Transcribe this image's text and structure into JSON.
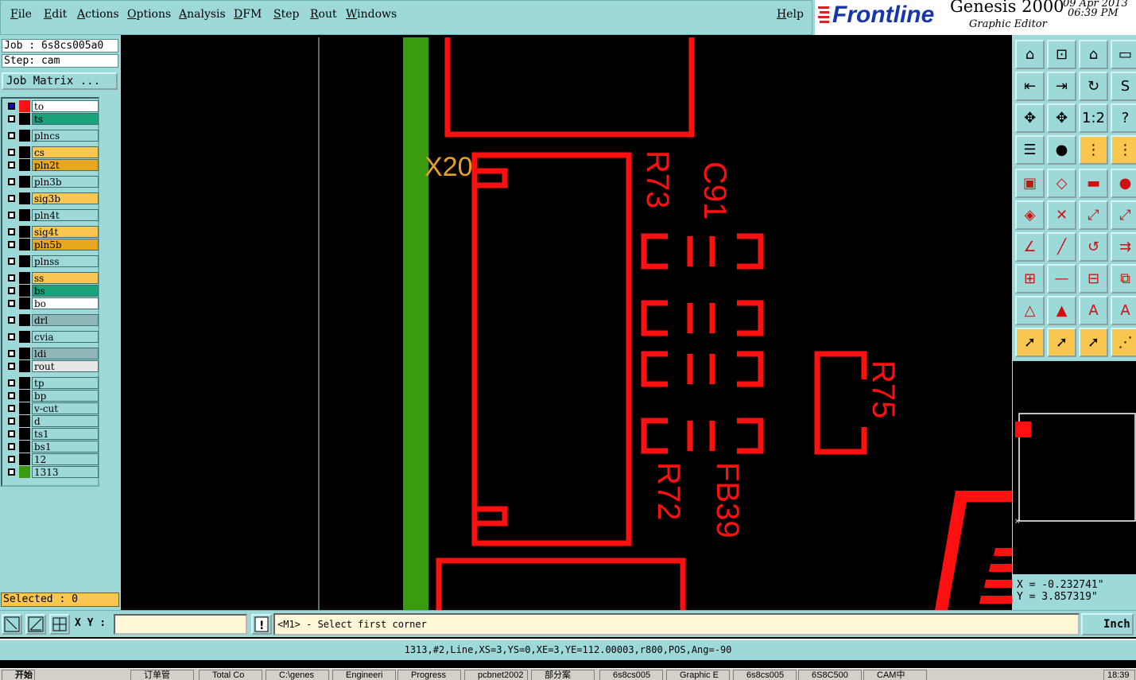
{
  "menu": [
    "File",
    "Edit",
    "Actions",
    "Options",
    "Analysis",
    "DFM",
    "Step",
    "Rout",
    "Windows"
  ],
  "help_label": "Help",
  "brand": {
    "logo": "Frontline",
    "product": "Genesis 2000",
    "subtitle": "Graphic Editor",
    "date": "09 Apr 2013",
    "time": "06:39 PM",
    "logo_color": "#1836a8"
  },
  "job": {
    "job_line": "Job : 6s8cs005a0",
    "step_line": "Step: cam",
    "matrix_button": "Job Matrix ..."
  },
  "layers": [
    {
      "name": "to",
      "color": "#ffffff",
      "swatch": "#ff1010",
      "active": true
    },
    {
      "name": "ts",
      "color": "#1aa37a",
      "swatch": "#000000"
    },
    {
      "name": "plncs",
      "color": "#9ed9d9",
      "swatch": "#000000"
    },
    {
      "name": "cs",
      "color": "#f9c750",
      "swatch": "#000000"
    },
    {
      "name": "pln2t",
      "color": "#e7a820",
      "swatch": "#000000"
    },
    {
      "name": "pln3b",
      "color": "#9ed9d9",
      "swatch": "#000000"
    },
    {
      "name": "sig3b",
      "color": "#f9c750",
      "swatch": "#000000"
    },
    {
      "name": "pln4t",
      "color": "#9ed9d9",
      "swatch": "#000000"
    },
    {
      "name": "sig4t",
      "color": "#f9c750",
      "swatch": "#000000"
    },
    {
      "name": "pln5b",
      "color": "#e7a820",
      "swatch": "#000000"
    },
    {
      "name": "plnss",
      "color": "#9ed9d9",
      "swatch": "#000000"
    },
    {
      "name": "ss",
      "color": "#f9c750",
      "swatch": "#000000"
    },
    {
      "name": "bs",
      "color": "#1aa37a",
      "swatch": "#000000"
    },
    {
      "name": "bo",
      "color": "#ffffff",
      "swatch": "#000000"
    },
    {
      "name": "drl",
      "color": "#8fb7b7",
      "swatch": "#000000"
    },
    {
      "name": "cvia",
      "color": "#9ed9d9",
      "swatch": "#000000"
    },
    {
      "name": "ldi",
      "color": "#8fb7b7",
      "swatch": "#000000"
    },
    {
      "name": "rout",
      "color": "#e6e6e6",
      "swatch": "#000000"
    },
    {
      "name": "tp",
      "color": "#9ed9d9",
      "swatch": "#000000"
    },
    {
      "name": "bp",
      "color": "#9ed9d9",
      "swatch": "#000000"
    },
    {
      "name": "v-cut",
      "color": "#9ed9d9",
      "swatch": "#000000"
    },
    {
      "name": "d",
      "color": "#9ed9d9",
      "swatch": "#000000"
    },
    {
      "name": "ts1",
      "color": "#9ed9d9",
      "swatch": "#000000"
    },
    {
      "name": "bs1",
      "color": "#9ed9d9",
      "swatch": "#000000"
    },
    {
      "name": "12",
      "color": "#9ed9d9",
      "swatch": "#000000"
    },
    {
      "name": "1313",
      "color": "#9ed9d9",
      "swatch": "#3a9a10"
    }
  ],
  "selected": "Selected : 0",
  "board": {
    "refdes": [
      "X20",
      "R73",
      "C91",
      "R75",
      "R72",
      "FB39"
    ],
    "trace_color": "#ff1010",
    "highlight_color": "#3a9a10",
    "label_color": "#e8a020"
  },
  "coords": {
    "x": "X = -0.232741\"",
    "y": "Y = 3.857319\""
  },
  "cmd": {
    "xy_label": "X Y :",
    "prompt": "<M1> - Select first corner",
    "unit": "Inch"
  },
  "status": "1313,#2,Line,XS=3,YS=0,XE=3,YE=112.00003,r800,POS,Ang=-90",
  "taskbar": {
    "start": "开始",
    "tasks": [
      "订单管",
      "Total Co",
      "C:\\genes",
      "Engineeri",
      "Progress",
      "pcbnet2002",
      "部分案",
      "6s8cs005",
      "Graphic E",
      "6s8cs005",
      "6S8C500",
      "CAM中"
    ],
    "clock": "18:39"
  }
}
